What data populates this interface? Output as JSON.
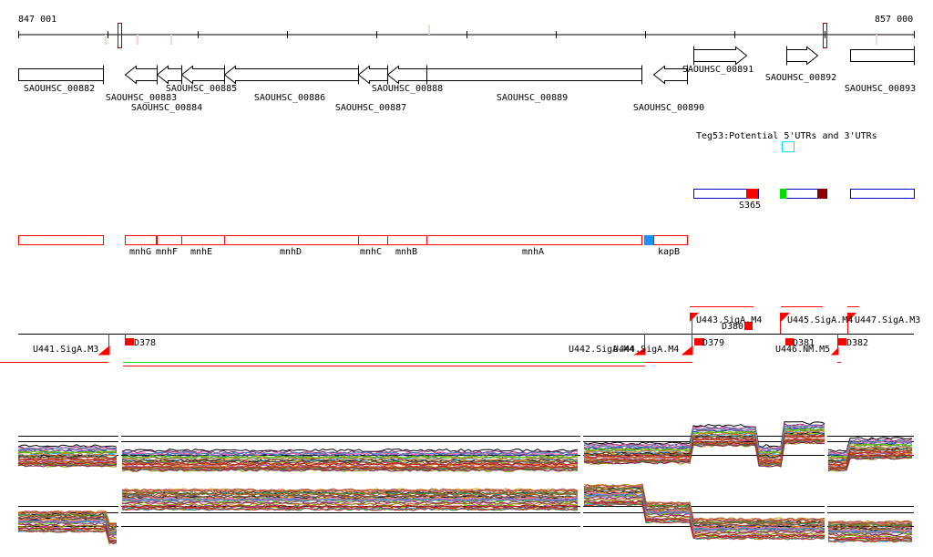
{
  "ruler": {
    "start_label": "847 001",
    "end_label": "857 000"
  },
  "genes": [
    {
      "id": "SAOUHSC_00882"
    },
    {
      "id": "SAOUHSC_00883"
    },
    {
      "id": "SAOUHSC_00884"
    },
    {
      "id": "SAOUHSC_00885"
    },
    {
      "id": "SAOUHSC_00886"
    },
    {
      "id": "SAOUHSC_00887"
    },
    {
      "id": "SAOUHSC_00888"
    },
    {
      "id": "SAOUHSC_00889"
    },
    {
      "id": "SAOUHSC_00890"
    },
    {
      "id": "SAOUHSC_00891"
    },
    {
      "id": "SAOUHSC_00892"
    },
    {
      "id": "SAOUHSC_00893"
    }
  ],
  "utr_track": {
    "title": "Teg53:Potential 5'UTRs and 3'UTRs",
    "feature_label": "S365"
  },
  "gene_names": [
    "mnhG",
    "mnhF",
    "mnhE",
    "mnhD",
    "mnhC",
    "mnhB",
    "mnhA",
    "kapB"
  ],
  "operon_track": {
    "labels": [
      "U441.SigA.M3",
      "D378",
      "U442.SigA.M4",
      "U444.SigA.M4",
      "U443.SigA.M4",
      "D380",
      "D379",
      "U445.SigA.M4",
      "U447.SigA.M3",
      "D381",
      "U446.NM.M5",
      "D382"
    ]
  },
  "colors": {
    "feature_red": "#ff0000",
    "dark_red": "#8b0000",
    "blue": "#0000cc",
    "cyan": "#00ffff",
    "green": "#00dd00",
    "kap_blue": "#1e90ff"
  }
}
